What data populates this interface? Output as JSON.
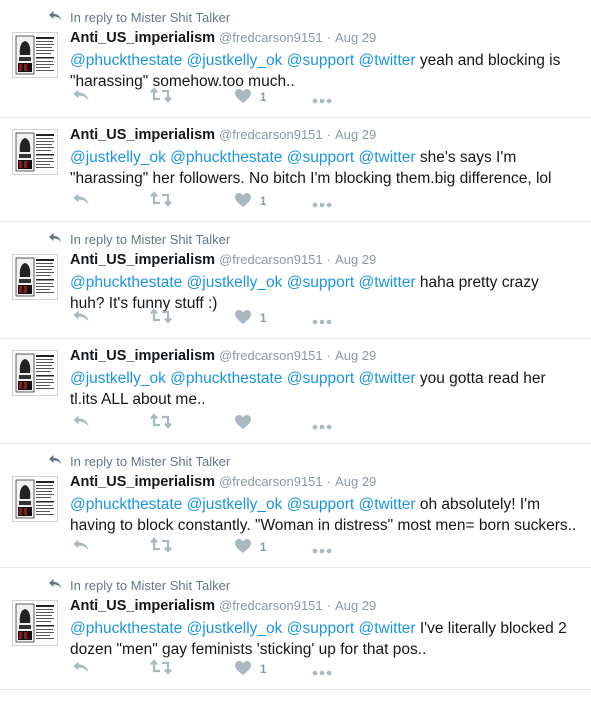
{
  "reply_context_prefix": "In reply to Mister Shit Talker",
  "dot": "·",
  "tweets": [
    {
      "reply_context": "In reply to Mister Shit Talker",
      "name": "Anti_US_imperialism",
      "handle": "@fredcarson9151",
      "time": "Aug 29",
      "parts": [
        {
          "t": "@phuckthestate",
          "m": true
        },
        {
          "t": " ",
          "m": false
        },
        {
          "t": "@justkelly_ok",
          "m": true
        },
        {
          "t": " ",
          "m": false
        },
        {
          "t": "@support",
          "m": true
        },
        {
          "t": " ",
          "m": false
        },
        {
          "t": "@twitter",
          "m": true
        },
        {
          "t": " yeah and blocking is \"harassing\" somehow.too much..",
          "m": false
        }
      ],
      "likes": "1"
    },
    {
      "reply_context": "",
      "name": "Anti_US_imperialism",
      "handle": "@fredcarson9151",
      "time": "Aug 29",
      "parts": [
        {
          "t": "@justkelly_ok",
          "m": true
        },
        {
          "t": " ",
          "m": false
        },
        {
          "t": "@phuckthestate",
          "m": true
        },
        {
          "t": " ",
          "m": false
        },
        {
          "t": "@support",
          "m": true
        },
        {
          "t": " ",
          "m": false
        },
        {
          "t": "@twitter",
          "m": true
        },
        {
          "t": " she's says I'm \"harassing\" her followers. No bitch I'm blocking them.big difference, lol",
          "m": false
        }
      ],
      "likes": "1"
    },
    {
      "reply_context": "In reply to Mister Shit Talker",
      "name": "Anti_US_imperialism",
      "handle": "@fredcarson9151",
      "time": "Aug 29",
      "parts": [
        {
          "t": "@phuckthestate",
          "m": true
        },
        {
          "t": " ",
          "m": false
        },
        {
          "t": "@justkelly_ok",
          "m": true
        },
        {
          "t": " ",
          "m": false
        },
        {
          "t": "@support",
          "m": true
        },
        {
          "t": " ",
          "m": false
        },
        {
          "t": "@twitter",
          "m": true
        },
        {
          "t": " haha pretty crazy huh? It's funny stuff :)",
          "m": false
        }
      ],
      "likes": "1"
    },
    {
      "reply_context": "",
      "name": "Anti_US_imperialism",
      "handle": "@fredcarson9151",
      "time": "Aug 29",
      "parts": [
        {
          "t": "@justkelly_ok",
          "m": true
        },
        {
          "t": " ",
          "m": false
        },
        {
          "t": "@phuckthestate",
          "m": true
        },
        {
          "t": " ",
          "m": false
        },
        {
          "t": "@support",
          "m": true
        },
        {
          "t": " ",
          "m": false
        },
        {
          "t": "@twitter",
          "m": true
        },
        {
          "t": " you gotta read her tl.its ALL about me..",
          "m": false
        }
      ],
      "likes": ""
    },
    {
      "reply_context": "In reply to Mister Shit Talker",
      "name": "Anti_US_imperialism",
      "handle": "@fredcarson9151",
      "time": "Aug 29",
      "parts": [
        {
          "t": "@phuckthestate",
          "m": true
        },
        {
          "t": " ",
          "m": false
        },
        {
          "t": "@justkelly_ok",
          "m": true
        },
        {
          "t": " ",
          "m": false
        },
        {
          "t": "@support",
          "m": true
        },
        {
          "t": " ",
          "m": false
        },
        {
          "t": "@twitter",
          "m": true
        },
        {
          "t": " oh absolutely!  I'm having to block constantly. \"Woman in distress\" most men= born suckers..",
          "m": false
        }
      ],
      "likes": "1"
    },
    {
      "reply_context": "In reply to Mister Shit Talker",
      "name": "Anti_US_imperialism",
      "handle": "@fredcarson9151",
      "time": "Aug 29",
      "parts": [
        {
          "t": "@phuckthestate",
          "m": true
        },
        {
          "t": " ",
          "m": false
        },
        {
          "t": "@justkelly_ok",
          "m": true
        },
        {
          "t": " ",
          "m": false
        },
        {
          "t": "@support",
          "m": true
        },
        {
          "t": " ",
          "m": false
        },
        {
          "t": "@twitter",
          "m": true
        },
        {
          "t": " I've literally blocked 2 dozen \"men\" gay feminists 'sticking' up for that pos..",
          "m": false
        }
      ],
      "likes": "1"
    }
  ],
  "colors": {
    "mention": "#1b95e0",
    "icon": "#aab8c2",
    "meta": "#8899a6",
    "divider": "#e1e8ed"
  },
  "icons": [
    "reply-arrow-icon",
    "reply-icon",
    "retweet-icon",
    "like-heart-icon",
    "more-dots-icon",
    "avatar-fist-poster-icon"
  ]
}
